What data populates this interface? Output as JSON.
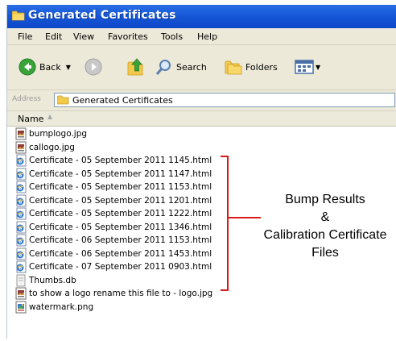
{
  "window": {
    "title": "Generated Certificates",
    "title_icon": "folder-icon",
    "accent_color": "#1658d8"
  },
  "menu": [
    "File",
    "Edit",
    "View",
    "Favorites",
    "Tools",
    "Help"
  ],
  "toolbar": {
    "back_label": "Back",
    "search_label": "Search",
    "folders_label": "Folders"
  },
  "address": {
    "label": "Address",
    "value": "Generated Certificates"
  },
  "columns": {
    "name": "Name"
  },
  "files": [
    {
      "name": "bumplogo.jpg",
      "icon": "image-file-icon"
    },
    {
      "name": "callogo.jpg",
      "icon": "image-file-icon"
    },
    {
      "name": "Certificate - 05 September 2011 1145.html",
      "icon": "html-file-icon"
    },
    {
      "name": "Certificate - 05 September 2011 1147.html",
      "icon": "html-file-icon"
    },
    {
      "name": "Certificate - 05 September 2011 1153.html",
      "icon": "html-file-icon"
    },
    {
      "name": "Certificate - 05 September 2011 1201.html",
      "icon": "html-file-icon"
    },
    {
      "name": "Certificate - 05 September 2011 1222.html",
      "icon": "html-file-icon"
    },
    {
      "name": "Certificate - 05 September 2011 1346.html",
      "icon": "html-file-icon"
    },
    {
      "name": "Certificate - 06 September 2011 1153.html",
      "icon": "html-file-icon"
    },
    {
      "name": "Certificate - 06 September 2011 1453.html",
      "icon": "html-file-icon"
    },
    {
      "name": "Certificate - 07 September 2011 0903.html",
      "icon": "html-file-icon"
    },
    {
      "name": "Thumbs.db",
      "icon": "db-file-icon"
    },
    {
      "name": "to show a logo rename this file to - logo.jpg",
      "icon": "image-file-icon"
    },
    {
      "name": "watermark.png",
      "icon": "png-file-icon"
    }
  ],
  "annotation": {
    "line1": "Bump Results",
    "line2": "&",
    "line3": "Calibration Certificate",
    "line4": "Files",
    "color": "#d81c1c"
  }
}
